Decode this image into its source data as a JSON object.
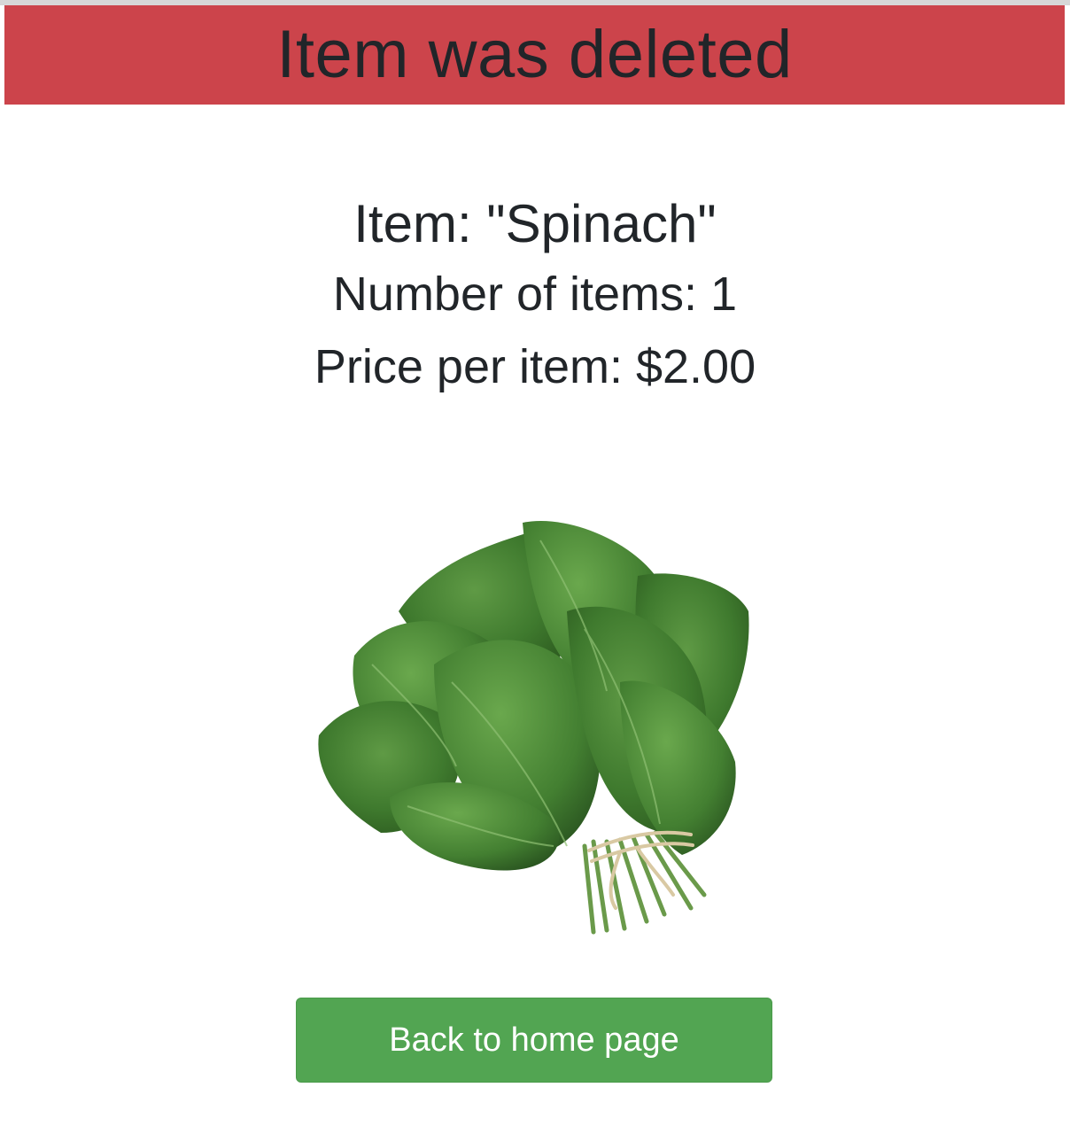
{
  "banner": {
    "message": "Item was deleted",
    "color": "#cc444b"
  },
  "item": {
    "name_line": "Item: \"Spinach\"",
    "count_line": "Number of items: 1",
    "price_line": "Price per item: $2.00",
    "image_icon": "spinach-bunch-image"
  },
  "actions": {
    "back_label": "Back to home page",
    "back_color": "#52a552"
  }
}
